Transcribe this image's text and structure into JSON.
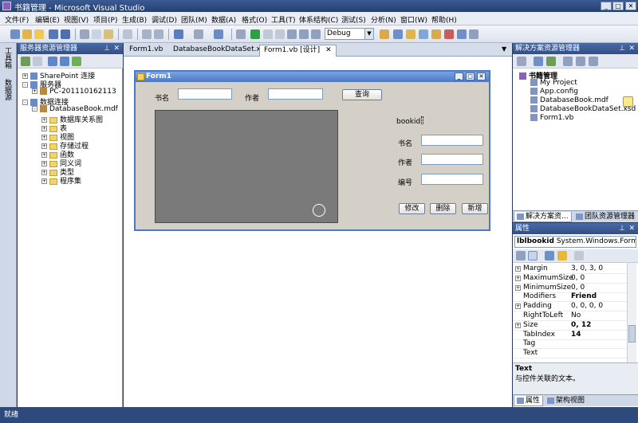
{
  "window": {
    "title": "书籍管理 - Microsoft Visual Studio"
  },
  "menu": [
    "文件(F)",
    "编辑(E)",
    "视图(V)",
    "项目(P)",
    "生成(B)",
    "调试(D)",
    "团队(M)",
    "数据(A)",
    "格式(O)",
    "工具(T)",
    "体系结构(C)",
    "测试(S)",
    "分析(N)",
    "窗口(W)",
    "帮助(H)"
  ],
  "toolbar": {
    "config": "Debug"
  },
  "left_tabs": [
    "工具箱",
    "数据源"
  ],
  "server_explorer": {
    "title": "服务器资源管理器",
    "tree": [
      {
        "label": "SharePoint 连接",
        "level": 0,
        "exp": "+"
      },
      {
        "label": "服务器",
        "level": 0,
        "exp": "-"
      },
      {
        "label": "PC-201110162113",
        "level": 1,
        "exp": "+"
      },
      {
        "label": "数据连接",
        "level": 0,
        "exp": "-"
      },
      {
        "label": "DatabaseBook.mdf",
        "level": 1,
        "exp": "-"
      },
      {
        "label": "数据库关系图",
        "level": 2,
        "exp": "+"
      },
      {
        "label": "表",
        "level": 2,
        "exp": "+"
      },
      {
        "label": "视图",
        "level": 2,
        "exp": "+"
      },
      {
        "label": "存储过程",
        "level": 2,
        "exp": "+"
      },
      {
        "label": "函数",
        "level": 2,
        "exp": "+"
      },
      {
        "label": "同义词",
        "level": 2,
        "exp": "+"
      },
      {
        "label": "类型",
        "level": 2,
        "exp": "+"
      },
      {
        "label": "程序集",
        "level": 2,
        "exp": "+"
      }
    ]
  },
  "doc_tabs": [
    "Form1.vb",
    "DatabaseBookDataSet.xsd",
    "Form1.vb [设计]"
  ],
  "form": {
    "title": "Form1",
    "search_name_label": "书名",
    "search_author_label": "作者",
    "search_button": "查询",
    "bookid_label": "bookid",
    "name_label": "书名",
    "author_label": "作者",
    "number_label": "编号",
    "edit_button": "修改",
    "delete_button": "删除",
    "add_button": "新增"
  },
  "solution_explorer": {
    "title": "解决方案资源管理器",
    "tree": [
      {
        "label": "书籍管理",
        "level": 0,
        "bold": true
      },
      {
        "label": "My Project",
        "level": 1
      },
      {
        "label": "App.config",
        "level": 1
      },
      {
        "label": "DatabaseBook.mdf",
        "level": 1
      },
      {
        "label": "DatabaseBookDataSet.xsd",
        "level": 1
      },
      {
        "label": "Form1.vb",
        "level": 1
      }
    ],
    "tabs": [
      "解决方案资...",
      "团队资源管理器"
    ]
  },
  "properties": {
    "title": "属性",
    "object": "lblbookid",
    "object_type": "System.Windows.Forms.",
    "rows": [
      {
        "name": "Margin",
        "value": "3, 0, 3, 0",
        "exp": true,
        "bold": false
      },
      {
        "name": "MaximumSize",
        "value": "0, 0",
        "exp": true,
        "bold": false
      },
      {
        "name": "MinimumSize",
        "value": "0, 0",
        "exp": true,
        "bold": false
      },
      {
        "name": "Modifiers",
        "value": "Friend",
        "exp": false,
        "bold": true
      },
      {
        "name": "Padding",
        "value": "0, 0, 0, 0",
        "exp": true,
        "bold": false
      },
      {
        "name": "RightToLeft",
        "value": "No",
        "exp": false,
        "bold": false
      },
      {
        "name": "Size",
        "value": "0, 12",
        "exp": true,
        "bold": true
      },
      {
        "name": "TabIndex",
        "value": "14",
        "exp": false,
        "bold": true
      },
      {
        "name": "Tag",
        "value": "",
        "exp": false,
        "bold": false
      },
      {
        "name": "Text",
        "value": "",
        "exp": false,
        "bold": false
      }
    ],
    "desc_title": "Text",
    "desc_text": "与控件关联的文本。",
    "tabs": [
      "属性",
      "架构视图"
    ]
  },
  "status": "就绪"
}
